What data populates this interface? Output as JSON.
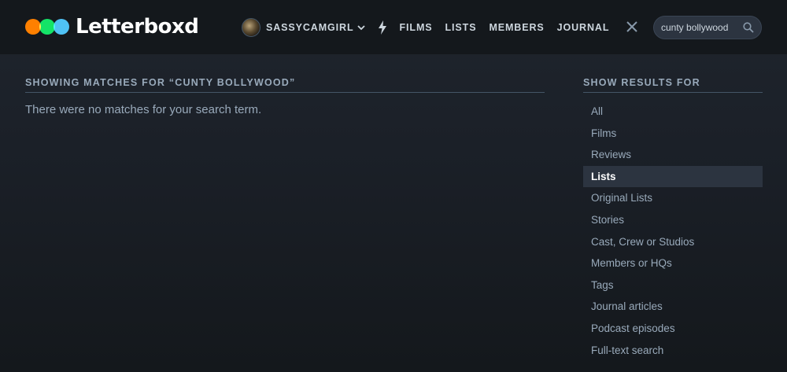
{
  "brand": {
    "name": "Letterboxd",
    "dot_colors": [
      "#ff8000",
      "#00e054",
      "#40bcf4"
    ]
  },
  "nav": {
    "username": "SASSYCAMGIRL",
    "links": [
      "FILMS",
      "LISTS",
      "MEMBERS",
      "JOURNAL"
    ]
  },
  "search": {
    "value": "cunty bollywood"
  },
  "results": {
    "heading": "SHOWING MATCHES FOR “CUNTY BOLLYWOOD”",
    "message": "There were no matches for your search term."
  },
  "sidebar": {
    "heading": "SHOW RESULTS FOR",
    "active_index": 3,
    "items": [
      "All",
      "Films",
      "Reviews",
      "Lists",
      "Original Lists",
      "Stories",
      "Cast, Crew or Studios",
      "Members or HQs",
      "Tags",
      "Journal articles",
      "Podcast episodes",
      "Full-text search"
    ]
  }
}
